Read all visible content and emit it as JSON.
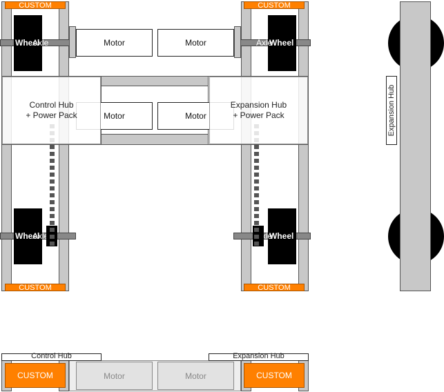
{
  "top_view": {
    "motors": [
      {
        "id": "front-left-motor",
        "label": "Motor"
      },
      {
        "id": "front-right-motor",
        "label": "Motor"
      },
      {
        "id": "center-left-motor",
        "label": "Motor"
      },
      {
        "id": "center-right-motor",
        "label": "Motor"
      }
    ],
    "custom_labels": [
      "CUSTOM",
      "CUSTOM",
      "CUSTOM",
      "CUSTOM"
    ],
    "wheels": {
      "front_left": {
        "wheel": "Wheel",
        "axle": "Axle"
      },
      "front_right": {
        "wheel": "Wheel",
        "axle": "Axle"
      },
      "rear_left": {
        "wheel": "Wheel",
        "axle": "Axle"
      },
      "rear_right": {
        "wheel": "Wheel",
        "axle": "Axle"
      }
    },
    "control_hub": {
      "line1": "Control Hub",
      "line2": "+ Power Pack"
    },
    "expansion_hub": {
      "line1": "Expansion Hub",
      "line2": "+ Power Pack"
    }
  },
  "side_view": {
    "hub_label": "Expansion Hub"
  },
  "front_view": {
    "control_hub": "Control Hub",
    "expansion_hub": "Expansion Hub",
    "custom_left": "CUSTOM",
    "custom_right": "CUSTOM",
    "motor_left": "Motor",
    "motor_right": "Motor"
  },
  "colors": {
    "custom": "#ff8000",
    "rail": "#c8c8c8",
    "wheel": "#000000"
  }
}
